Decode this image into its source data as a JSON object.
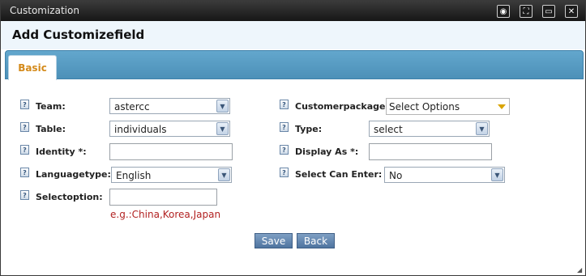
{
  "window": {
    "title": "Customization"
  },
  "dialog": {
    "heading": "Add Customizefield"
  },
  "tabs": [
    {
      "label": "Basic"
    }
  ],
  "form": {
    "team": {
      "label": "Team:",
      "value": "astercc"
    },
    "table": {
      "label": "Table:",
      "value": "individuals"
    },
    "identity": {
      "label": "Identity *:",
      "value": ""
    },
    "languagetype": {
      "label": "Languagetype:",
      "value": "English"
    },
    "selectoption": {
      "label": "Selectoption:",
      "value": "",
      "hint": "e.g.:China,Korea,Japan"
    },
    "customerpackage": {
      "label": "Customerpackage:",
      "value": "Select Options"
    },
    "type": {
      "label": "Type:",
      "value": "select"
    },
    "display_as": {
      "label": "Display As *:",
      "value": ""
    },
    "select_can_enter": {
      "label": "Select Can Enter:",
      "value": "No"
    }
  },
  "buttons": {
    "save": "Save",
    "back": "Back"
  },
  "icons": {
    "help": "help-icon",
    "title_buttons": [
      "record-icon",
      "fit-icon",
      "maximize-icon",
      "close-icon"
    ]
  },
  "colors": {
    "titlebar": "#1c1c1c",
    "tabbar": "#5a9cc4",
    "tab_label": "#d48a1a",
    "hint": "#b22222",
    "button": "#5f82ad"
  }
}
